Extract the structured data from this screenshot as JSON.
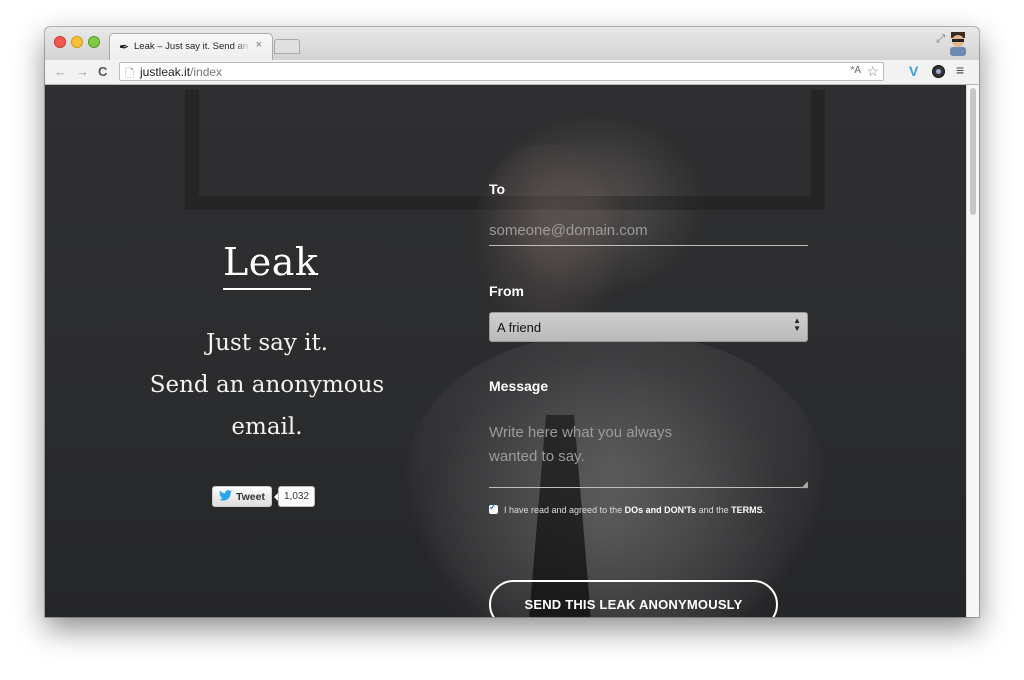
{
  "browser": {
    "tab_title": "Leak – Just say it. Send an",
    "tab_close": "×",
    "url_host": "justleak.it",
    "url_path": "/index",
    "icons": {
      "back": "←",
      "forward": "→",
      "reload": "C",
      "page": "🗋",
      "translate": "*A",
      "star": "☆",
      "ext_v": "V",
      "menu": "≡",
      "fullscreen": "⤢",
      "favicon": "✒"
    }
  },
  "hero": {
    "brand": "Leak",
    "tagline_line1": "Just say it.",
    "tagline_line2": "Send an anonymous",
    "tagline_line3": "email.",
    "tweet_label": "Tweet",
    "tweet_count": "1,032"
  },
  "form": {
    "to_label": "To",
    "to_placeholder": "someone@domain.com",
    "from_label": "From",
    "from_value": "A friend",
    "message_label": "Message",
    "message_placeholder": "Write here what you always wanted to say.",
    "agree_text_1": "I have read and agreed to the",
    "agree_link_dos": "DOs and DON'Ts",
    "agree_text_2": "and the",
    "agree_link_terms": "TERMS",
    "agree_text_3": ".",
    "send_button": "SEND THIS LEAK ANONYMOUSLY"
  },
  "colors": {
    "page_background": "#2e2f31",
    "text": "#ffffff",
    "placeholder": "#9c9c9c",
    "twitter_blue": "#2aa3ef"
  }
}
